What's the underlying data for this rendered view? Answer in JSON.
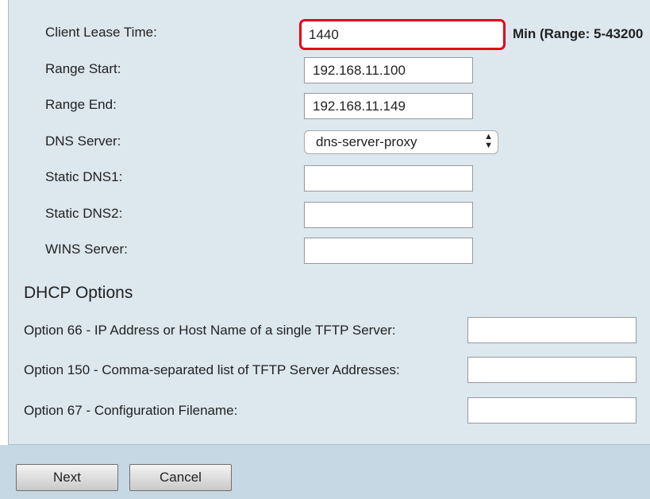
{
  "fields": {
    "client_lease_time": {
      "label": "Client Lease Time:",
      "value": "1440",
      "hint": "Min (Range: 5-43200"
    },
    "range_start": {
      "label": "Range Start:",
      "value": "192.168.11.100"
    },
    "range_end": {
      "label": "Range End:",
      "value": "192.168.11.149"
    },
    "dns_server": {
      "label": "DNS Server:",
      "selected": "dns-server-proxy"
    },
    "static_dns1": {
      "label": "Static DNS1:",
      "value": ""
    },
    "static_dns2": {
      "label": "Static DNS2:",
      "value": ""
    },
    "wins_server": {
      "label": "WINS Server:",
      "value": ""
    }
  },
  "dhcp_options": {
    "title": "DHCP Options",
    "option66": {
      "label": "Option 66 - IP Address or Host Name of a single TFTP Server:",
      "value": ""
    },
    "option150": {
      "label": "Option 150 - Comma-separated list of TFTP Server Addresses:",
      "value": ""
    },
    "option67": {
      "label": "Option 67 - Configuration Filename:",
      "value": ""
    }
  },
  "buttons": {
    "next": "Next",
    "cancel": "Cancel"
  },
  "colors": {
    "panel": "#dce7ee",
    "footer": "#c6d8e4",
    "highlight": "#e3001b"
  },
  "icons": {
    "dns_select": "select-updown-arrows-icon"
  }
}
